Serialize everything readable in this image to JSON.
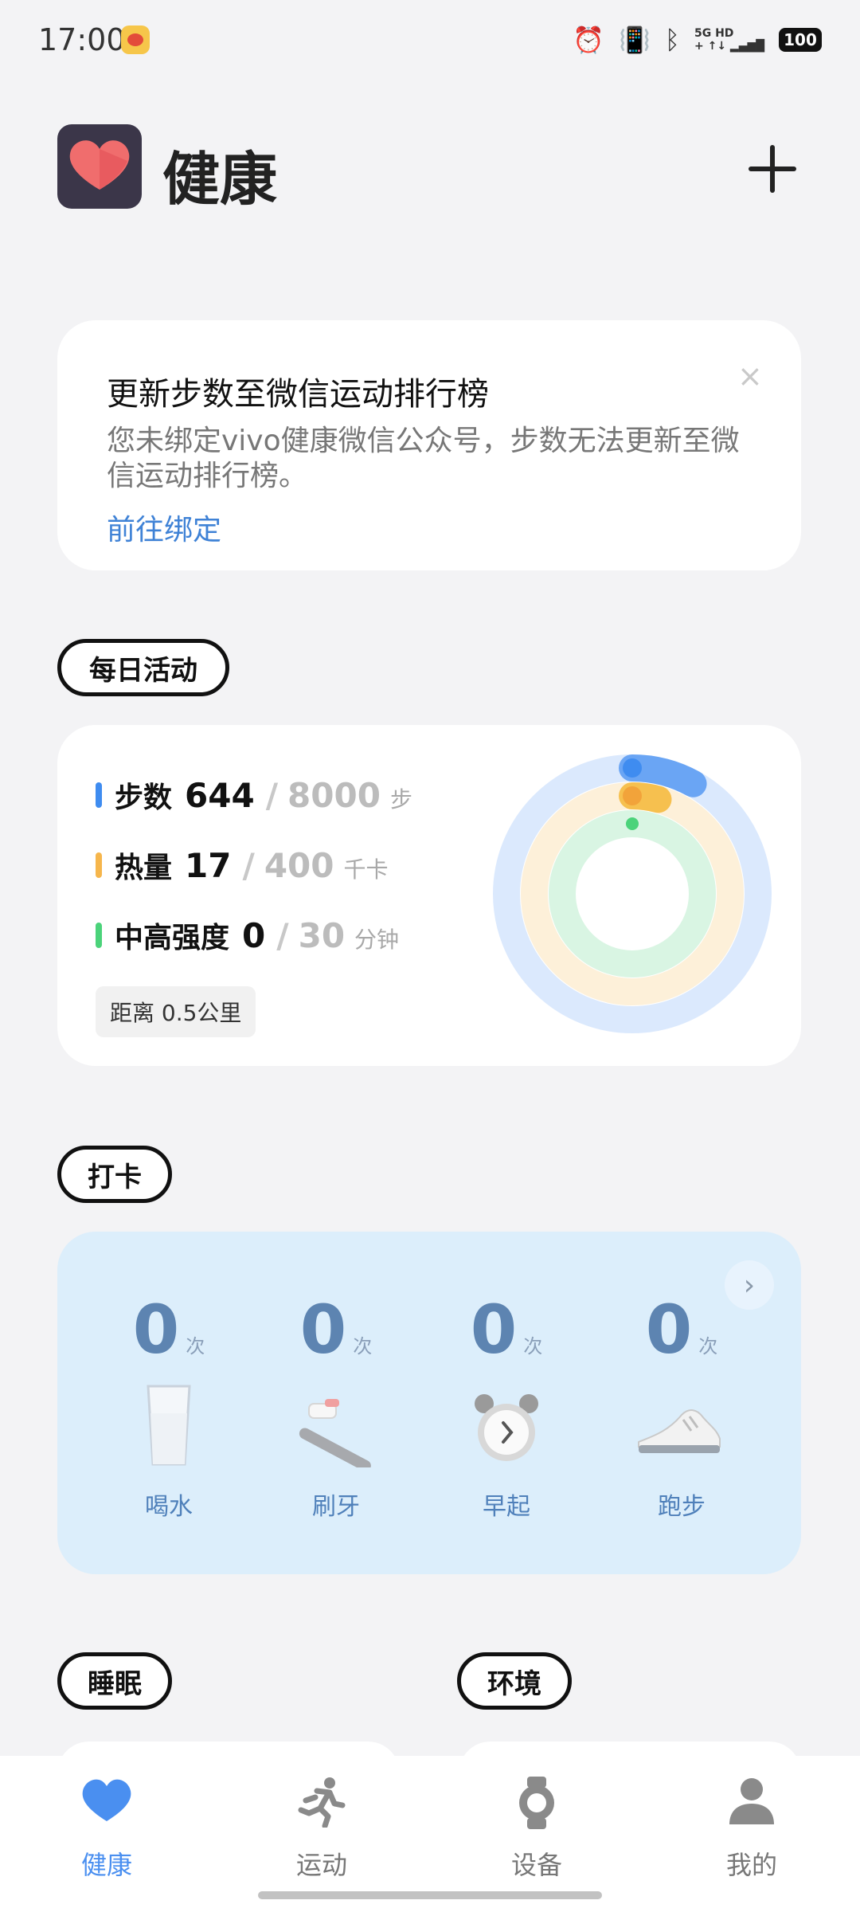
{
  "status_bar": {
    "time": "17:00",
    "net_top": "5G HD",
    "net_bottom": "+ ↑↓ ▂▄▆█",
    "battery": "100"
  },
  "header": {
    "title": "健康"
  },
  "banner": {
    "title": "更新步数至微信运动排行榜",
    "description": "您未绑定vivo健康微信公众号，步数无法更新至微信运动排行榜。",
    "link": "前往绑定",
    "close": "×"
  },
  "daily_activity": {
    "section_label": "每日活动",
    "metrics": [
      {
        "label": "步数",
        "value": "644",
        "sep": "/",
        "goal": "8000",
        "unit": "步",
        "color": "#3f8cf0",
        "progress": 0.0805
      },
      {
        "label": "热量",
        "value": "17",
        "sep": "/",
        "goal": "400",
        "unit": "千卡",
        "color": "#f6b64c",
        "progress": 0.0425
      },
      {
        "label": "中高强度",
        "value": "0",
        "sep": "/",
        "goal": "30",
        "unit": "分钟",
        "color": "#4bd37a",
        "progress": 0
      }
    ],
    "distance": "距离  0.5公里"
  },
  "checkin": {
    "section_label": "打卡",
    "next": "›",
    "items": [
      {
        "count": "0",
        "unit": "次",
        "label": "喝水",
        "icon": "water-glass-icon"
      },
      {
        "count": "0",
        "unit": "次",
        "label": "刷牙",
        "icon": "toothbrush-icon"
      },
      {
        "count": "0",
        "unit": "次",
        "label": "早起",
        "icon": "alarm-clock-icon"
      },
      {
        "count": "0",
        "unit": "次",
        "label": "跑步",
        "icon": "running-shoe-icon"
      }
    ]
  },
  "sections": {
    "sleep": "睡眠",
    "environment": "环境"
  },
  "bottom_nav": [
    {
      "label": "健康",
      "active": true,
      "color": "#4a8ff0"
    },
    {
      "label": "运动",
      "active": false,
      "color": "#777777"
    },
    {
      "label": "设备",
      "active": false,
      "color": "#777777"
    },
    {
      "label": "我的",
      "active": false,
      "color": "#777777"
    }
  ]
}
